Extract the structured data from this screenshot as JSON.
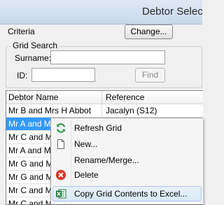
{
  "window": {
    "title": "Debtor Selec"
  },
  "criteria": {
    "label": "Criteria",
    "change_button": "Change..."
  },
  "grid_search": {
    "group_label": "Grid Search",
    "surname_label": "Surname:",
    "surname_value": "",
    "id_label": "ID:",
    "id_value": "",
    "find_button": "Find"
  },
  "grid": {
    "columns": [
      "Debtor Name",
      "Reference"
    ],
    "rows": [
      {
        "name": "Mr B and Mrs H Abbot",
        "reference": "Jacalyn (S12)"
      },
      {
        "name": "Mr A and Mrs",
        "reference": ""
      },
      {
        "name": "Mr C and Mrs",
        "reference": ""
      },
      {
        "name": "Mr A and Mrs",
        "reference": ""
      },
      {
        "name": "Mr G and Mrs",
        "reference": ""
      },
      {
        "name": "Mr G and Mrs",
        "reference": ""
      },
      {
        "name": "Mr C and Mrs",
        "reference": ""
      },
      {
        "name": "Mr C and Mrs",
        "reference": ""
      }
    ]
  },
  "context_menu": {
    "items": [
      {
        "label": "Refresh Grid",
        "icon": "refresh-icon"
      },
      {
        "label": "New...",
        "icon": "new-document-icon"
      },
      {
        "label": "Rename/Merge...",
        "icon": ""
      },
      {
        "label": "Delete",
        "icon": "delete-icon"
      },
      {
        "label": "Copy Grid Contents to Excel...",
        "icon": "excel-icon"
      }
    ]
  },
  "colors": {
    "selection": "#3399ff",
    "delete_icon": "#d93b2b",
    "refresh_icon": "#2e9e4f",
    "excel_icon": "#1d7a3c"
  }
}
